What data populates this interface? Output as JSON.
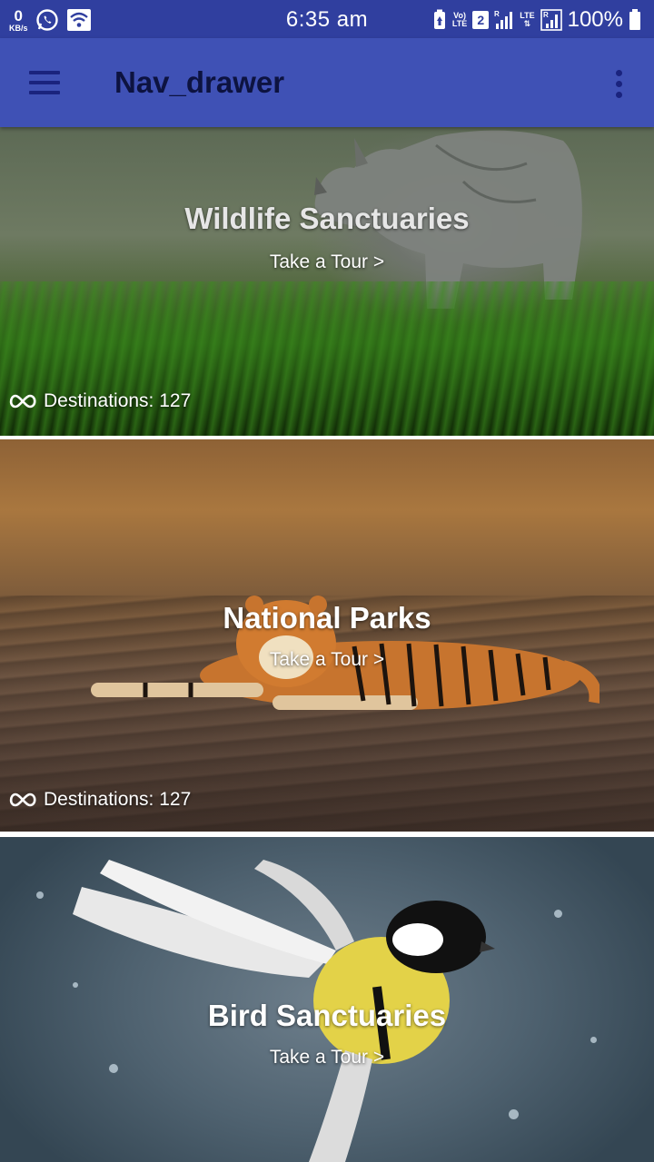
{
  "status_bar": {
    "net_speed_value": "0",
    "net_speed_unit": "KB/s",
    "time": "6:35 am",
    "volte_label_top": "Vo)",
    "volte_label_bottom": "LTE",
    "sim_slot": "2",
    "lte_label": "LTE",
    "battery_percent": "100%"
  },
  "app_bar": {
    "title": "Nav_drawer",
    "menu_icon": "hamburger-menu-icon",
    "overflow_icon": "more-vert-icon"
  },
  "cards": [
    {
      "title": "Wildlife Sanctuaries",
      "cta": "Take a Tour >",
      "destinations": "Destinations: 127",
      "icon": "infinity-icon"
    },
    {
      "title": "National Parks",
      "cta": "Take a Tour >",
      "destinations": "Destinations: 127",
      "icon": "infinity-icon"
    },
    {
      "title": "Bird Sanctuaries",
      "cta": "Take a Tour >"
    }
  ],
  "colors": {
    "status_bar": "#303f9f",
    "app_bar": "#3f51b5",
    "title_text": "#0d1340"
  }
}
